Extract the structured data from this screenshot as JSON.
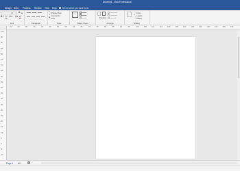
{
  "window": {
    "title": "Drawing1 - Visio Professional"
  },
  "tabs": [
    {
      "label": "Design"
    },
    {
      "label": "Data"
    },
    {
      "label": "Process"
    },
    {
      "label": "Review"
    },
    {
      "label": "View"
    },
    {
      "label": "Help"
    }
  ],
  "tell_me": {
    "placeholder": "Tell me what you want to do"
  },
  "ribbon": {
    "groups": [
      {
        "label": "Font"
      },
      {
        "label": "Paragraph"
      },
      {
        "label": "Tools"
      },
      {
        "label": "Shape Styles"
      },
      {
        "label": "Arrange"
      },
      {
        "label": "Editing"
      }
    ],
    "tools": {
      "pointer_tool": "Pointer Tool",
      "connector": "Connector",
      "text": "Text"
    },
    "arrange": {
      "position": "Position"
    },
    "editing": {
      "find": "Find",
      "layers": "Layers",
      "select": "Select"
    }
  },
  "ruler": {
    "top": [
      "20",
      "25",
      "30",
      "35",
      "40",
      "45",
      "50",
      "55",
      "60",
      "65",
      "70",
      "75",
      "80",
      "85",
      "90",
      "95",
      "100",
      "105",
      "110",
      "115",
      "120",
      "125",
      "130",
      "135",
      "140",
      "145",
      "150",
      "155",
      "160"
    ],
    "left": [
      "100",
      "95",
      "90",
      "85",
      "80",
      "75",
      "70",
      "65",
      "60",
      "55",
      "50",
      "45",
      "40",
      "35",
      "30",
      "25",
      "20",
      "15",
      "10",
      "5",
      "0",
      "-5",
      "-10"
    ]
  },
  "page_tabs": [
    {
      "label": "Page-1"
    },
    {
      "label": "All"
    }
  ],
  "add_page": "+"
}
